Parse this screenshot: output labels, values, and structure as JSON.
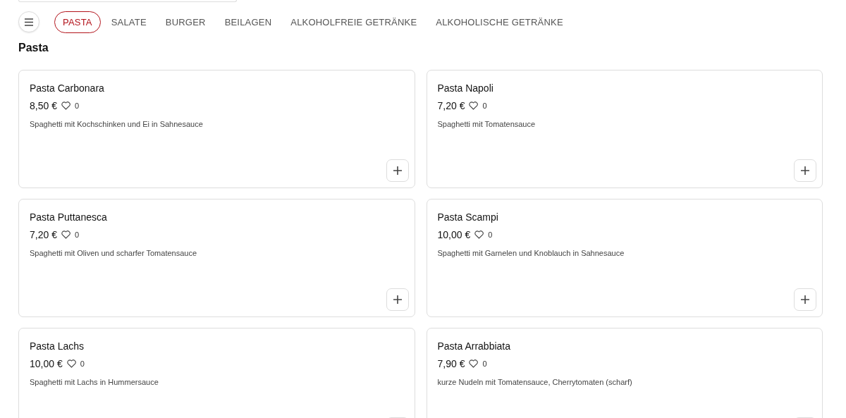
{
  "categories": [
    {
      "label": "PASTA",
      "selected": true
    },
    {
      "label": "SALATE",
      "selected": false
    },
    {
      "label": "BURGER",
      "selected": false
    },
    {
      "label": "BEILAGEN",
      "selected": false
    },
    {
      "label": "ALKOHOLFREIE GETRÄNKE",
      "selected": false
    },
    {
      "label": "ALKOHOLISCHE GETRÄNKE",
      "selected": false
    }
  ],
  "section_title": "Pasta",
  "items": [
    {
      "name": "Pasta Carbonara",
      "price": "8,50 €",
      "likes": "0",
      "description": "Spaghetti mit Kochschinken und Ei in Sahnesauce"
    },
    {
      "name": "Pasta Napoli",
      "price": "7,20 €",
      "likes": "0",
      "description": "Spaghetti mit Tomatensauce"
    },
    {
      "name": "Pasta Puttanesca",
      "price": "7,20 €",
      "likes": "0",
      "description": "Spaghetti mit Oliven und scharfer Tomatensauce"
    },
    {
      "name": "Pasta Scampi",
      "price": "10,00 €",
      "likes": "0",
      "description": "Spaghetti mit Garnelen und Knoblauch in Sahnesauce"
    },
    {
      "name": "Pasta Lachs",
      "price": "10,00 €",
      "likes": "0",
      "description": "Spaghetti mit Lachs in Hummersauce"
    },
    {
      "name": "Pasta Arrabbiata",
      "price": "7,90 €",
      "likes": "0",
      "description": "kurze Nudeln mit Tomatensauce, Cherrytomaten (scharf)"
    }
  ]
}
